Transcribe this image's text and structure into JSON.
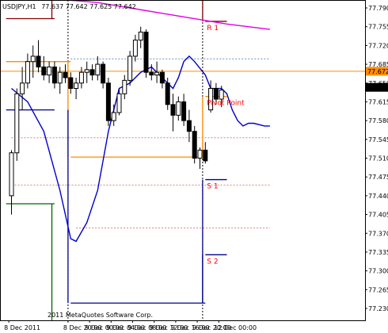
{
  "header": {
    "symbol": "USDJPY,H1",
    "ohlc": "77.637 77.642 77.625 77.642"
  },
  "chart_data": {
    "type": "candlestick",
    "symbol": "USDJPY",
    "timeframe": "H1",
    "ylim": [
      77.208,
      77.815
    ],
    "y_ticks": [
      77.79,
      77.755,
      77.72,
      77.685,
      77.65,
      77.615,
      77.58,
      77.545,
      77.51,
      77.475,
      77.44,
      77.405,
      77.37,
      77.335,
      77.3,
      77.265,
      77.23
    ],
    "y_tick_labels": [
      "77.790",
      "77.755",
      "77.720",
      "77.685",
      "77.650",
      "77.615",
      "77.580",
      "77.545",
      "77.510",
      "77.475",
      "77.440",
      "77.405",
      "77.370",
      "77.335",
      "77.300",
      "77.265",
      "77.230"
    ],
    "x_tick_labels": [
      "8 Dec 2011",
      "8 Dec 20:00",
      "9 Dec 00:00",
      "9 Dec 04:00",
      "9 Dec 08:00",
      "9 Dec 12:00",
      "9 Dec 16:00",
      "9 Dec 20:00",
      "12 Dec 00:00"
    ],
    "x_tick_index": [
      0,
      11,
      15,
      19,
      23,
      27,
      31,
      35,
      39
    ],
    "candles": [
      {
        "o": 77.44,
        "h": 77.525,
        "l": 77.405,
        "c": 77.52
      },
      {
        "o": 77.52,
        "h": 77.64,
        "l": 77.505,
        "c": 77.63
      },
      {
        "o": 77.63,
        "h": 77.68,
        "l": 77.6,
        "c": 77.65
      },
      {
        "o": 77.65,
        "h": 77.705,
        "l": 77.64,
        "c": 77.69
      },
      {
        "o": 77.69,
        "h": 77.72,
        "l": 77.66,
        "c": 77.7
      },
      {
        "o": 77.7,
        "h": 77.73,
        "l": 77.67,
        "c": 77.68
      },
      {
        "o": 77.68,
        "h": 77.7,
        "l": 77.655,
        "c": 77.665
      },
      {
        "o": 77.665,
        "h": 77.69,
        "l": 77.65,
        "c": 77.68
      },
      {
        "o": 77.68,
        "h": 77.69,
        "l": 77.64,
        "c": 77.65
      },
      {
        "o": 77.65,
        "h": 77.68,
        "l": 77.63,
        "c": 77.67
      },
      {
        "o": 77.67,
        "h": 77.685,
        "l": 77.65,
        "c": 77.66
      },
      {
        "o": 77.66,
        "h": 77.67,
        "l": 77.63,
        "c": 77.64
      },
      {
        "o": 77.64,
        "h": 77.66,
        "l": 77.62,
        "c": 77.65
      },
      {
        "o": 77.65,
        "h": 77.68,
        "l": 77.64,
        "c": 77.67
      },
      {
        "o": 77.67,
        "h": 77.69,
        "l": 77.65,
        "c": 77.675
      },
      {
        "o": 77.675,
        "h": 77.685,
        "l": 77.655,
        "c": 77.665
      },
      {
        "o": 77.665,
        "h": 77.7,
        "l": 77.655,
        "c": 77.685
      },
      {
        "o": 77.685,
        "h": 77.69,
        "l": 77.64,
        "c": 77.65
      },
      {
        "o": 77.65,
        "h": 77.66,
        "l": 77.57,
        "c": 77.58
      },
      {
        "o": 77.58,
        "h": 77.61,
        "l": 77.57,
        "c": 77.595
      },
      {
        "o": 77.595,
        "h": 77.64,
        "l": 77.59,
        "c": 77.63
      },
      {
        "o": 77.63,
        "h": 77.665,
        "l": 77.62,
        "c": 77.655
      },
      {
        "o": 77.655,
        "h": 77.71,
        "l": 77.645,
        "c": 77.7
      },
      {
        "o": 77.7,
        "h": 77.74,
        "l": 77.69,
        "c": 77.73
      },
      {
        "o": 77.73,
        "h": 77.755,
        "l": 77.715,
        "c": 77.745
      },
      {
        "o": 77.745,
        "h": 77.75,
        "l": 77.66,
        "c": 77.67
      },
      {
        "o": 77.67,
        "h": 77.685,
        "l": 77.655,
        "c": 77.665
      },
      {
        "o": 77.665,
        "h": 77.69,
        "l": 77.65,
        "c": 77.67
      },
      {
        "o": 77.67,
        "h": 77.675,
        "l": 77.64,
        "c": 77.65
      },
      {
        "o": 77.65,
        "h": 77.66,
        "l": 77.6,
        "c": 77.61
      },
      {
        "o": 77.61,
        "h": 77.63,
        "l": 77.56,
        "c": 77.59
      },
      {
        "o": 77.59,
        "h": 77.625,
        "l": 77.58,
        "c": 77.615
      },
      {
        "o": 77.615,
        "h": 77.63,
        "l": 77.57,
        "c": 77.58
      },
      {
        "o": 77.58,
        "h": 77.6,
        "l": 77.54,
        "c": 77.56
      },
      {
        "o": 77.56,
        "h": 77.57,
        "l": 77.5,
        "c": 77.51
      },
      {
        "o": 77.51,
        "h": 77.53,
        "l": 77.49,
        "c": 77.525
      },
      {
        "o": 77.525,
        "h": 77.54,
        "l": 77.5,
        "c": 77.505
      },
      {
        "o": 77.6,
        "h": 77.655,
        "l": 77.595,
        "c": 77.64
      },
      {
        "o": 77.64,
        "h": 77.65,
        "l": 77.61,
        "c": 77.62
      },
      {
        "o": 77.62,
        "h": 77.645,
        "l": 77.605,
        "c": 77.637
      }
    ],
    "moving_averages": [
      {
        "color": "#e000e0",
        "points": [
          [
            0,
            77.81
          ],
          [
            6,
            77.81
          ],
          [
            10,
            77.805
          ],
          [
            16,
            77.8
          ],
          [
            22,
            77.79
          ],
          [
            28,
            77.78
          ],
          [
            34,
            77.77
          ],
          [
            40,
            77.76
          ],
          [
            48,
            77.75
          ]
        ]
      },
      {
        "color": "#0000cc",
        "points": [
          [
            0,
            77.64
          ],
          [
            3,
            77.615
          ],
          [
            6,
            77.56
          ],
          [
            9,
            77.45
          ],
          [
            11,
            77.36
          ],
          [
            12,
            77.355
          ],
          [
            14,
            77.39
          ],
          [
            16,
            77.45
          ],
          [
            18,
            77.56
          ],
          [
            20,
            77.64
          ],
          [
            22,
            77.65
          ],
          [
            24,
            77.67
          ],
          [
            26,
            77.68
          ],
          [
            28,
            77.66
          ],
          [
            30,
            77.64
          ],
          [
            31,
            77.66
          ],
          [
            32,
            77.69
          ],
          [
            33,
            77.7
          ],
          [
            34,
            77.69
          ],
          [
            36,
            77.665
          ],
          [
            37,
            77.64
          ],
          [
            39,
            77.64
          ],
          [
            40,
            77.63
          ],
          [
            41,
            77.6
          ],
          [
            42,
            77.58
          ],
          [
            43,
            77.57
          ],
          [
            44,
            77.575
          ],
          [
            45,
            77.575
          ],
          [
            47,
            77.57
          ],
          [
            48,
            77.57
          ]
        ]
      }
    ],
    "pivot_levels": [
      {
        "name": "R 1",
        "label": "R 1",
        "value": 77.765,
        "color": "#800000",
        "from": 36,
        "to": 40
      },
      {
        "name": "Pivot",
        "label": "Pivot Point",
        "value": 77.625,
        "color": "#ff8c00",
        "from": 36,
        "to": 40
      },
      {
        "name": "S 1",
        "label": "S 1",
        "value": 77.47,
        "color": "#00008b",
        "from": 36,
        "to": 40
      },
      {
        "name": "S 2",
        "label": "S 2",
        "value": 77.33,
        "color": "#00008b",
        "from": 36,
        "to": 40
      }
    ],
    "prev_pivot_levels": [
      {
        "name": "R 1 prev",
        "value": 77.77,
        "color": "#800000",
        "from": -1,
        "to": 8
      },
      {
        "name": "Pivot prev",
        "value": 77.69,
        "color": "#ff8c00",
        "from": -1,
        "to": 11
      },
      {
        "name": "Pivot prev 2",
        "value": 77.512,
        "color": "#ff8c00",
        "from": 11,
        "to": 36
      },
      {
        "name": "S 1 prev",
        "value": 77.6,
        "color": "#00008b",
        "from": -1,
        "to": 8
      },
      {
        "name": "S 1 prev 2",
        "value": 77.24,
        "color": "#00008b",
        "from": 11,
        "to": 36
      },
      {
        "name": "S 2 prev",
        "value": 77.425,
        "color": "#006400",
        "from": -1,
        "to": 8
      }
    ],
    "dotted_levels": [
      {
        "value": 77.695,
        "color": "#6a8fbf",
        "from": 11,
        "to": 48
      },
      {
        "value": 77.548,
        "color": "#e08080",
        "from": 0,
        "to": 48
      },
      {
        "value": 77.46,
        "color": "#e08080",
        "from": 0,
        "to": 48
      },
      {
        "value": 77.38,
        "color": "#e08080",
        "from": 12,
        "to": 48
      }
    ],
    "highlighted_prices": [
      {
        "label": "77.672",
        "value": 77.672,
        "bg": "#ff8c00",
        "fg": "#ffffff"
      },
      {
        "label": "77.642",
        "value": 77.642,
        "bg": "#000000",
        "fg": "#ffffff"
      }
    ],
    "hline_value": 77.672,
    "period_separators": [
      11,
      36
    ]
  },
  "watermark": "2011 MetaQuotes Software Corp."
}
